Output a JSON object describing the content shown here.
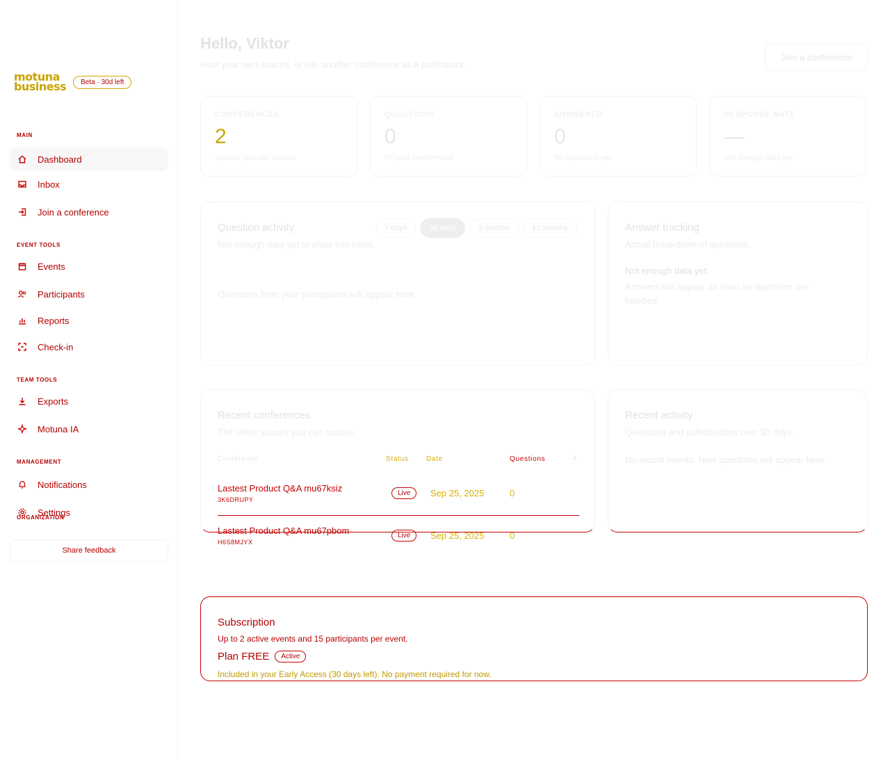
{
  "sidebar": {
    "brand": {
      "line1": "motuna",
      "line2": "business",
      "badge": "Beta · 30d left"
    },
    "sections": {
      "main": "Main",
      "event_tools": "Event tools",
      "team_tools": "Team tools",
      "management": "Management",
      "organization": "Organization"
    },
    "items": {
      "dashboard": "Dashboard",
      "inbox": "Inbox",
      "join": "Join a conference",
      "events": "Events",
      "participants": "Participants",
      "reports": "Reports",
      "checkin": "Check-in",
      "exports": "Exports",
      "motuna_ia": "Motuna IA",
      "notifications": "Notifications",
      "settings": "Settings"
    },
    "feedback": "Share feedback"
  },
  "header": {
    "greeting": "Hello, Viktor",
    "subtitle": "Host your own spaces, or join another conference as a participant.",
    "join_button": "Join a conference"
  },
  "stats": [
    {
      "label": "Conferences",
      "value": "2",
      "sub": "Spaces you can access"
    },
    {
      "label": "Questions",
      "value": "0",
      "sub": "All your conferences"
    },
    {
      "label": "Answered",
      "value": "0",
      "sub": "No questions yet"
    },
    {
      "label": "Response rate",
      "value": "—",
      "sub": "Not enough data yet"
    }
  ],
  "question_activity": {
    "title": "Question activity",
    "subtitle": "Not enough data yet to show this trend.",
    "empty": "Questions from your participants will appear here.",
    "ranges": [
      "7 days",
      "30 days",
      "3 months",
      "12 months"
    ],
    "selected_range": "30 days"
  },
  "answer_tracking": {
    "title": "Answer tracking",
    "subtitle": "Actual breakdown of questions.",
    "empty_title": "Not enough data yet",
    "empty_text": "Answers will appear as soon as questions are handled."
  },
  "recent_conferences": {
    "title": "Recent conferences",
    "subtitle": "The latest spaces you can access.",
    "columns": [
      "Conference",
      "Status",
      "Date",
      "Questions",
      "A"
    ],
    "rows": [
      {
        "title": "Lastest Product Q&A mu67ksiz",
        "code": "3K6DRUPY",
        "status": "Live",
        "date": "Sep 25, 2025",
        "questions": "0"
      },
      {
        "title": "Lastest Product Q&A mu67pbom",
        "code": "H6S8MJYX",
        "status": "Live",
        "date": "Sep 25, 2025",
        "questions": "0"
      }
    ]
  },
  "recent_activity": {
    "title": "Recent activity",
    "subtitle": "Questions and collaborators over 30 days.",
    "empty": "No recent events. New questions will appear here."
  },
  "subscription": {
    "title": "Subscription",
    "description": "Up to 2 active events and 15 participants per event.",
    "plan": "Plan FREE",
    "badge": "Active",
    "note": "Included in your Early Access (30 days left). No payment required for now."
  }
}
